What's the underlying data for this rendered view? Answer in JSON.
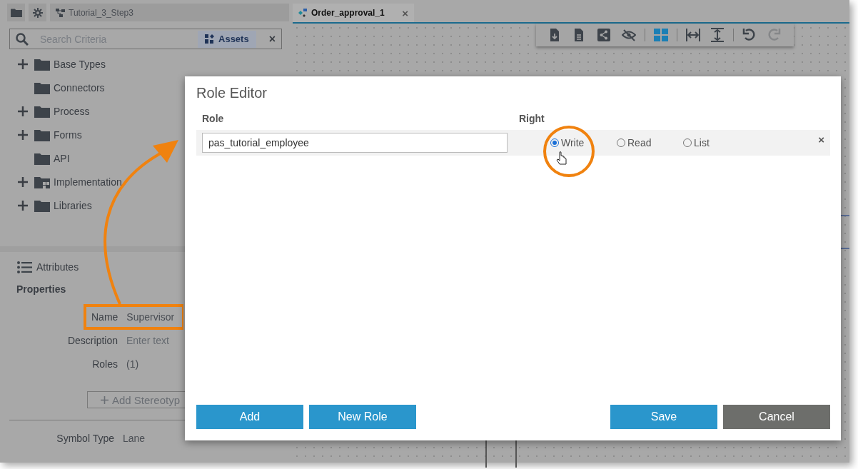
{
  "left_toolbar": {
    "project_tab": "Tutorial_3_Step3"
  },
  "search": {
    "placeholder": "Search Criteria",
    "filter": "Assets",
    "clear": "×"
  },
  "tree": [
    {
      "label": "Base Types",
      "expandable": true,
      "kind": "folder"
    },
    {
      "label": "Connectors",
      "expandable": false,
      "kind": "folder"
    },
    {
      "label": "Process",
      "expandable": true,
      "kind": "folder"
    },
    {
      "label": "Forms",
      "expandable": true,
      "kind": "folder"
    },
    {
      "label": "API",
      "expandable": false,
      "kind": "folder"
    },
    {
      "label": "Implementation",
      "expandable": true,
      "kind": "implementation"
    },
    {
      "label": "Libraries",
      "expandable": true,
      "kind": "folder"
    }
  ],
  "attributes": {
    "title": "Attributes",
    "section": "Properties",
    "fields": [
      {
        "label": "Name",
        "value": "Supervisor"
      },
      {
        "label": "Description",
        "placeholder": "Enter text"
      },
      {
        "label": "Roles",
        "value": "(1)"
      }
    ],
    "add_button": "Add Stereotyp",
    "symbol_type": {
      "label": "Symbol Type",
      "value": "Lane"
    }
  },
  "editor_tab": {
    "label": "Order_approval_1",
    "close": "×"
  },
  "canvas_toolbar": [
    {
      "selected": false,
      "disabled": false
    },
    {
      "selected": false,
      "disabled": false
    },
    {
      "selected": false,
      "disabled": false
    },
    {
      "selected": false,
      "disabled": false
    },
    {
      "selected": true,
      "disabled": false
    },
    {
      "selected": false,
      "disabled": false
    },
    {
      "selected": false,
      "disabled": false
    },
    {
      "selected": false,
      "disabled": false
    },
    {
      "selected": false,
      "disabled": true
    }
  ],
  "role_editor": {
    "title": "Role Editor",
    "columns": [
      "Role",
      "Right"
    ],
    "rows": [
      {
        "role": "pas_tutorial_employee",
        "rights": [
          {
            "label": "Write",
            "selected": true
          },
          {
            "label": "Read",
            "selected": false
          },
          {
            "label": "List",
            "selected": false
          }
        ],
        "delete": "×"
      }
    ],
    "buttons": [
      {
        "label": "Add",
        "kind": "primary"
      },
      {
        "label": "New Role",
        "kind": "primary"
      },
      {
        "label": "Save",
        "kind": "primary"
      },
      {
        "label": "Cancel",
        "kind": "secondary"
      }
    ]
  }
}
